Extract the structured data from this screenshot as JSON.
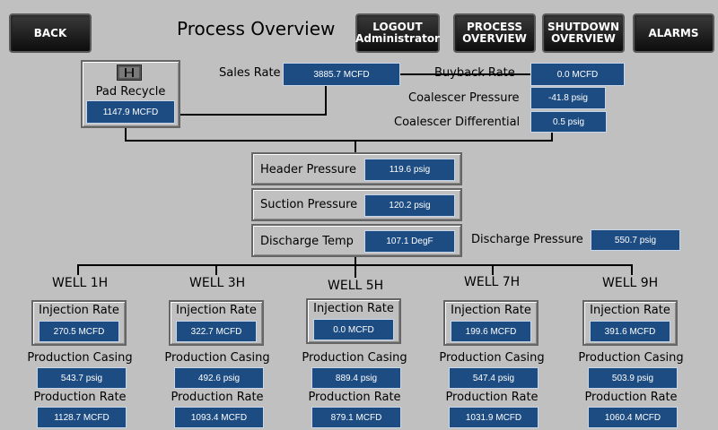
{
  "title": "Process Overview",
  "nav": {
    "back": "BACK",
    "logout_line1": "LOGOUT",
    "logout_line2": "Administrator",
    "process_line1": "PROCESS",
    "process_line2": "OVERVIEW",
    "shutdown_line1": "SHUTDOWN",
    "shutdown_line2": "OVERVIEW",
    "alarms": "ALARMS"
  },
  "pad_recycle": {
    "label": "Pad Recycle",
    "value": "1147.9 MCFD",
    "icon": "valve-icon"
  },
  "sales_rate": {
    "label": "Sales Rate",
    "value": "3885.7 MCFD"
  },
  "buyback_rate": {
    "label": "Buyback Rate",
    "value": "0.0 MCFD"
  },
  "coalescer_pressure": {
    "label": "Coalescer Pressure",
    "value": "-41.8 psig"
  },
  "coalescer_differential": {
    "label": "Coalescer Differential",
    "value": "0.5 psig"
  },
  "header_pressure": {
    "label": "Header Pressure",
    "value": "119.6 psig"
  },
  "suction_pressure": {
    "label": "Suction Pressure",
    "value": "120.2 psig"
  },
  "discharge_temp": {
    "label": "Discharge Temp",
    "value": "107.1 DegF"
  },
  "discharge_pressure": {
    "label": "Discharge Pressure",
    "value": "550.7 psig"
  },
  "labels": {
    "injection_rate": "Injection Rate",
    "production_casing": "Production Casing",
    "production_rate": "Production Rate"
  },
  "wells": [
    {
      "name": "WELL 1H",
      "injection_rate": "270.5 MCFD",
      "production_casing": "543.7 psig",
      "production_rate": "1128.7 MCFD"
    },
    {
      "name": "WELL 3H",
      "injection_rate": "322.7 MCFD",
      "production_casing": "492.6 psig",
      "production_rate": "1093.4 MCFD"
    },
    {
      "name": "WELL 5H",
      "injection_rate": "0.0 MCFD",
      "production_casing": "889.4 psig",
      "production_rate": "879.1 MCFD"
    },
    {
      "name": "WELL 7H",
      "injection_rate": "199.6 MCFD",
      "production_casing": "547.4 psig",
      "production_rate": "1031.9 MCFD"
    },
    {
      "name": "WELL 9H",
      "injection_rate": "391.6 MCFD",
      "production_casing": "503.9 psig",
      "production_rate": "1060.4 MCFD"
    }
  ]
}
